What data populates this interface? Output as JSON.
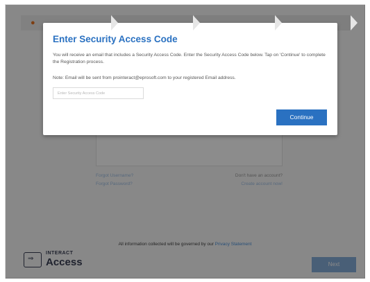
{
  "modal": {
    "title": "Enter Security Access Code",
    "description": "You will receive an email that includes a Security Access Code. Enter the Security Access Code below. Tap on 'Continue' to complete the Registration process.",
    "note": "Note: Email will be sent from prointeract@eprosoft.com to your registered Email address.",
    "code_input": {
      "placeholder": "Enter Security Access Code",
      "value": ""
    },
    "continue_label": "Continue"
  },
  "background": {
    "stepper": {
      "accent_color": "#e37222",
      "steps": [
        {
          "icon": "user-icon",
          "label": ""
        },
        {
          "label": ""
        },
        {
          "label": ""
        },
        {
          "label": ""
        }
      ]
    },
    "links": {
      "forgot_username": "Forgot Username?",
      "forgot_password": "Forgot Password?",
      "no_account": "Don't have an account?",
      "create_account": "Create account now!"
    },
    "footer": {
      "prefix": "All information collected will be governed by our",
      "privacy_link": "Privacy Statement"
    },
    "logo": {
      "icon": "sign-in-box-icon",
      "line1": "INTERACT",
      "line2": "Access"
    },
    "next_label": "Next"
  },
  "colors": {
    "primary": "#2a71c1",
    "overlay": "rgba(0,0,0,0.45)"
  }
}
